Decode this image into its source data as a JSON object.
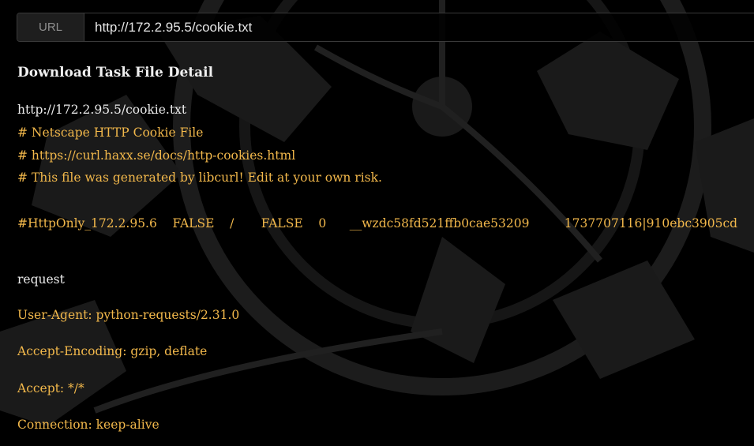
{
  "url_bar": {
    "label": "URL",
    "value": "http://172.2.95.5/cookie.txt"
  },
  "title": "Download Task File Detail",
  "file": {
    "url_line": "http://172.2.95.5/cookie.txt",
    "comment_lines": [
      "# Netscape HTTP Cookie File",
      "# https://curl.haxx.se/docs/http-cookies.html",
      "# This file was generated by libcurl! Edit at your own risk."
    ],
    "cookie_line": "#HttpOnly_172.2.95.6    FALSE    /       FALSE    0      __wzdc58fd521ffb0cae53209         1737707116|910ebc3905cd"
  },
  "request": {
    "label": "request",
    "headers": [
      "User-Agent: python-requests/2.31.0",
      "Accept-Encoding: gzip, deflate",
      "Accept: */*",
      "Connection: keep-alive"
    ]
  },
  "colors": {
    "background": "#000000",
    "text_white": "#ececec",
    "text_orange": "#f2b84b"
  }
}
